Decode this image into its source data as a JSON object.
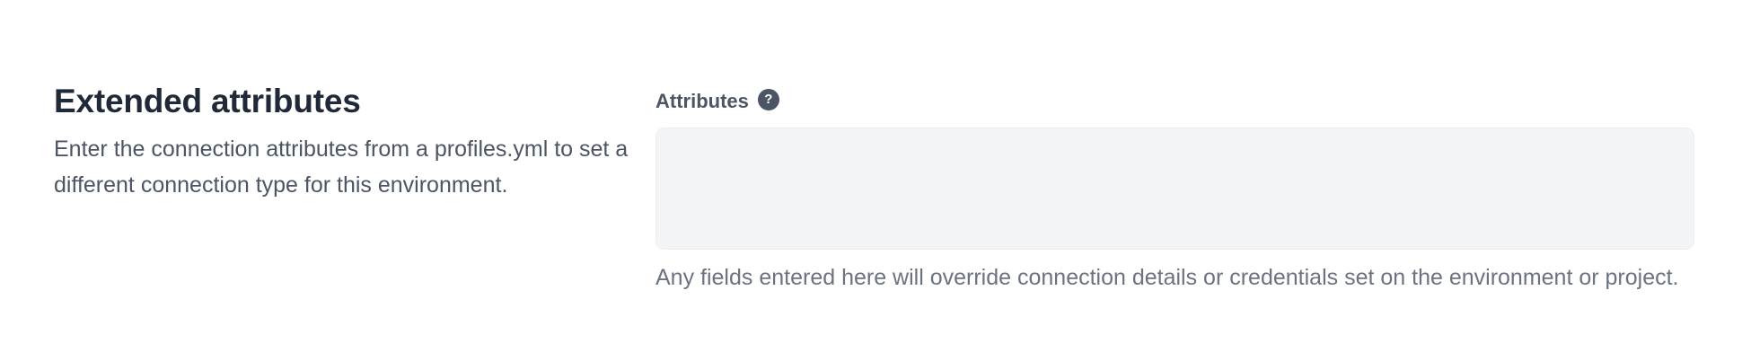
{
  "extended_attributes": {
    "title": "Extended attributes",
    "description": "Enter the connection attributes from a profiles.yml to set a different connection type for this environment.",
    "field": {
      "label": "Attributes",
      "help_icon": "question-circle-icon",
      "help_glyph": "?",
      "value": "",
      "hint": "Any fields entered here will override connection details or credentials set on the environment or project."
    }
  }
}
